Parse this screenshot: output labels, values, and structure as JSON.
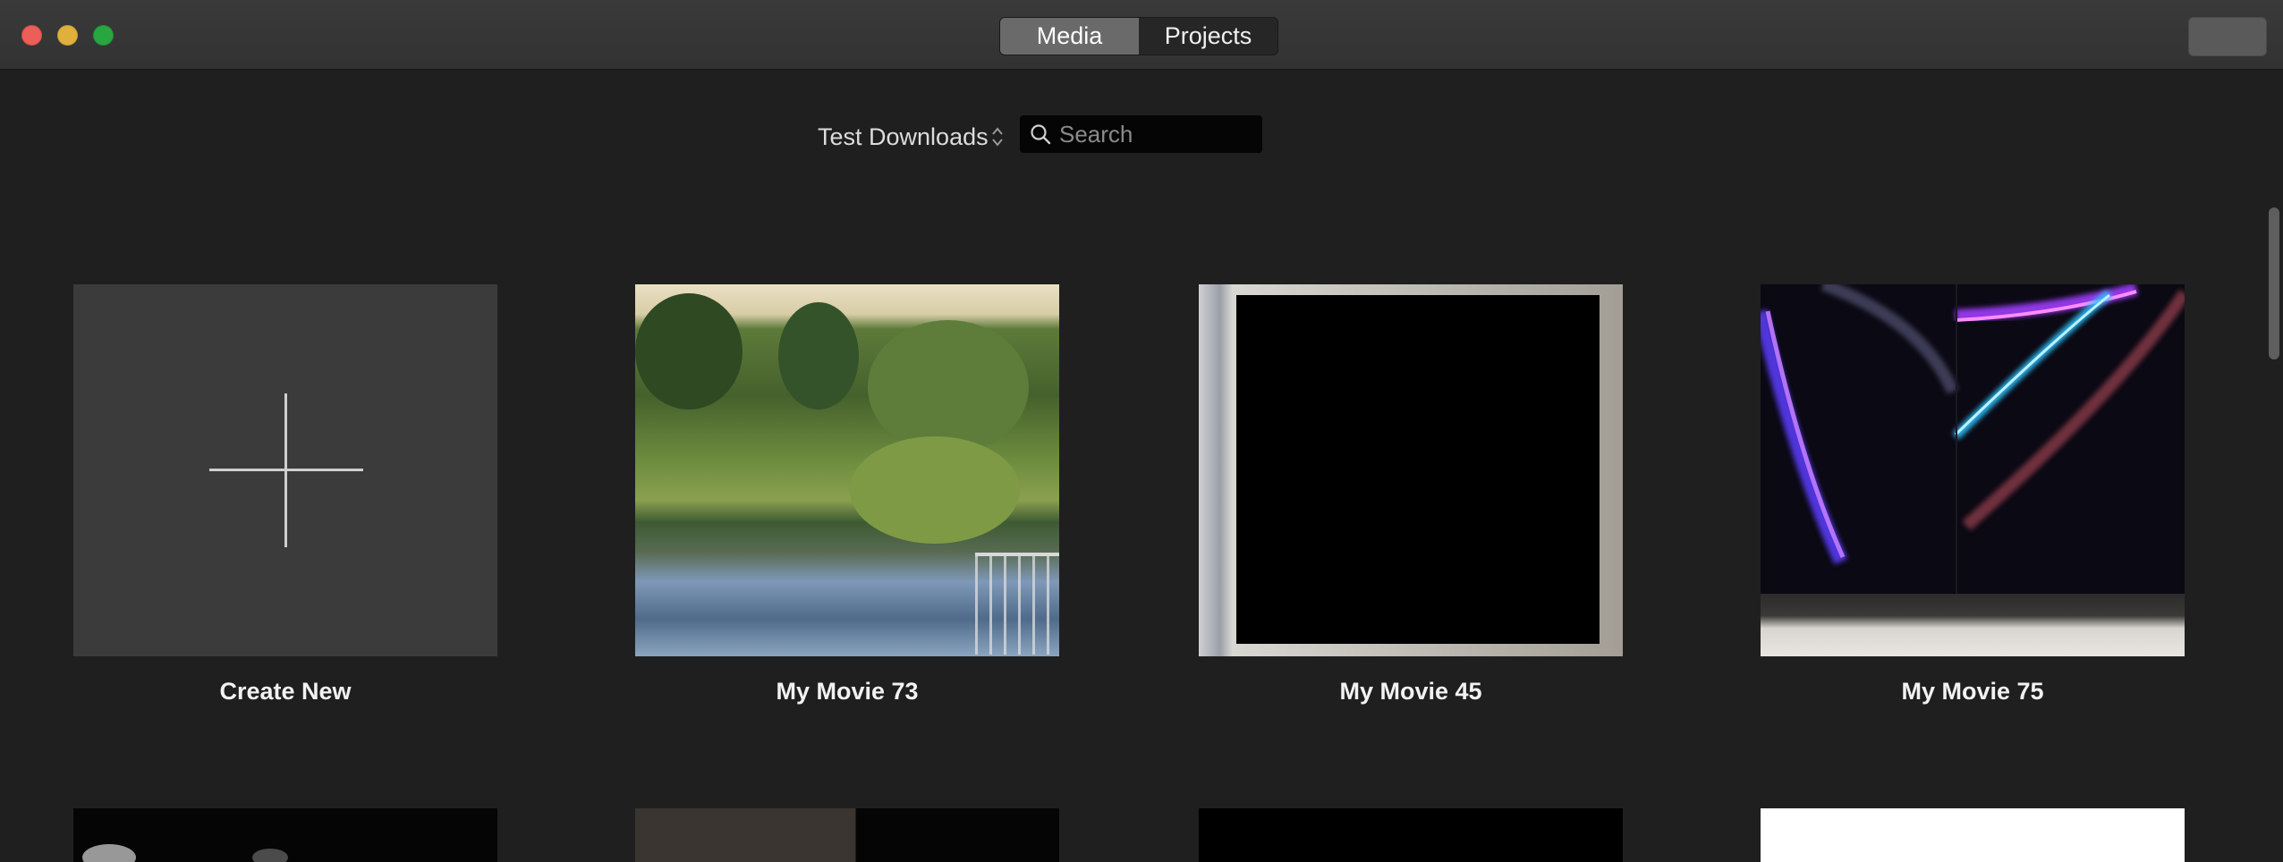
{
  "window": {
    "traffic_lights": {
      "close_color": "#ec5f58",
      "minimize_color": "#dfb13c",
      "maximize_color": "#2aa640"
    }
  },
  "toolbar": {
    "tabs": [
      {
        "label": "Media",
        "active": true
      },
      {
        "label": "Projects",
        "active": false
      }
    ]
  },
  "filter": {
    "library": "Test Downloads",
    "search_placeholder": "Search",
    "search_value": ""
  },
  "grid": {
    "create_new_label": "Create New",
    "items": [
      {
        "title": "My Movie 73",
        "thumbnail": "pond"
      },
      {
        "title": "My Movie 45",
        "thumbnail": "black-frame"
      },
      {
        "title": "My Movie 75",
        "thumbnail": "light-streaks"
      }
    ]
  }
}
